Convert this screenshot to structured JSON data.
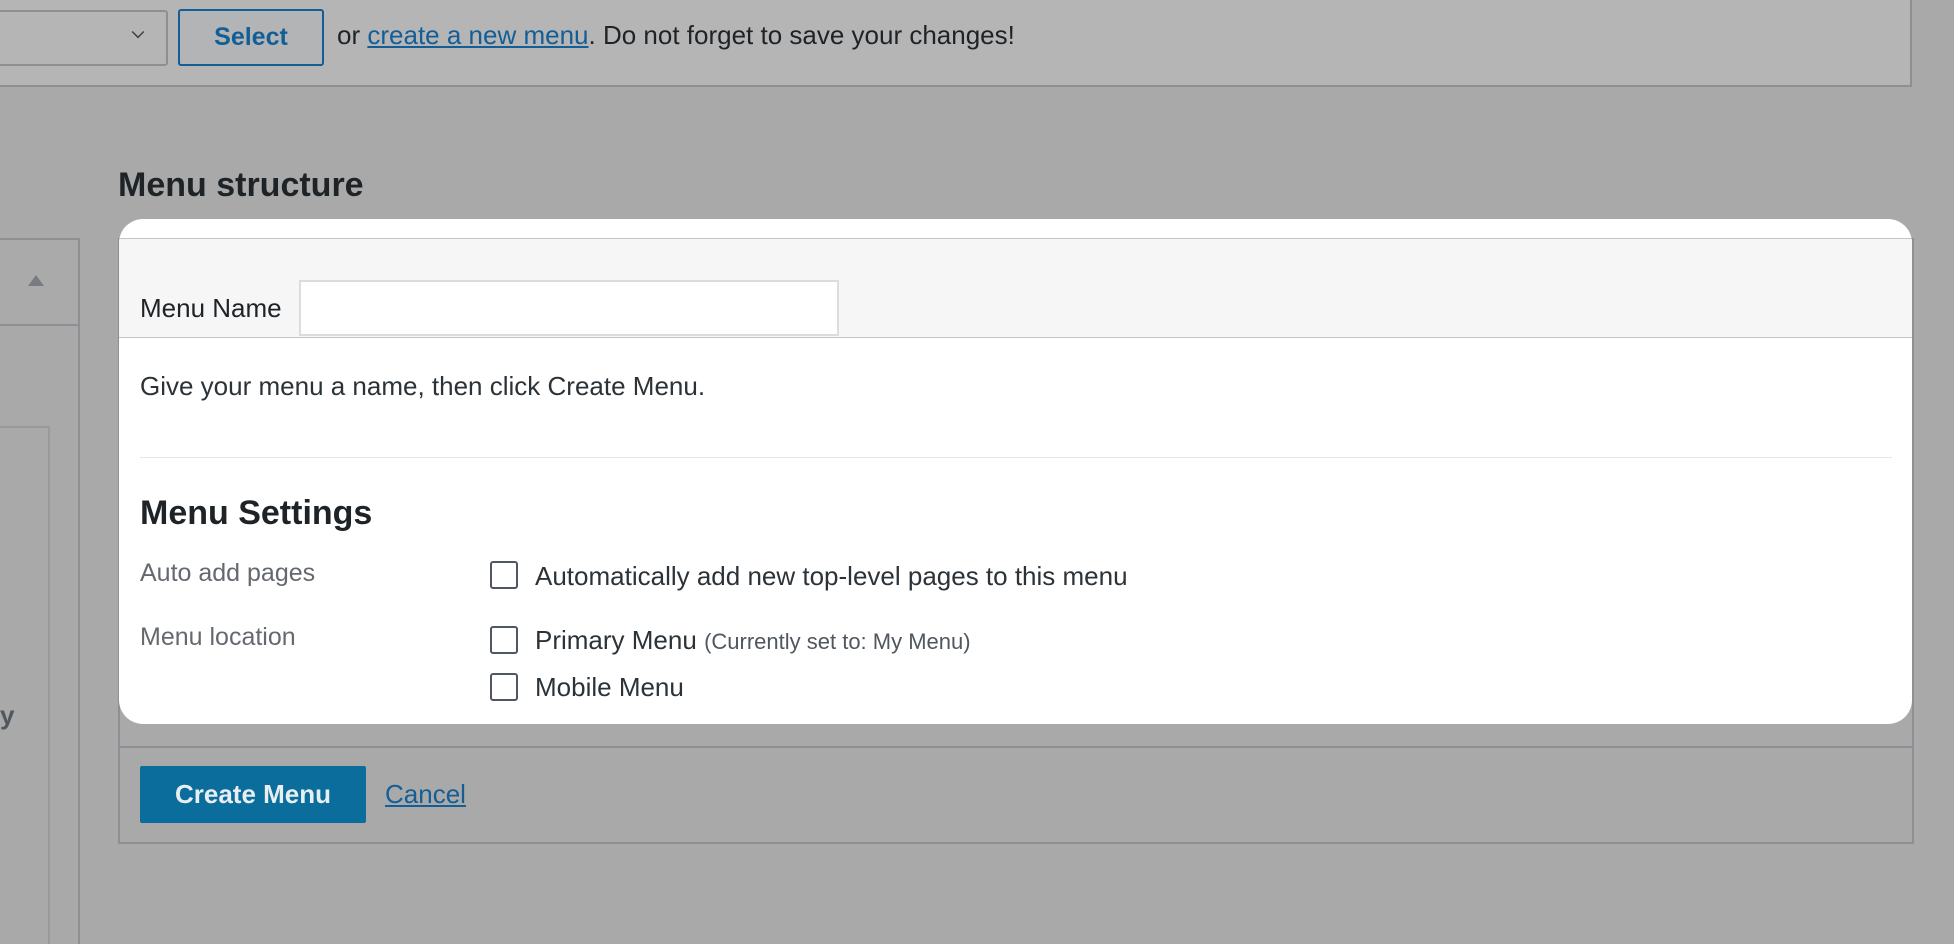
{
  "select_bar": {
    "button_label": "Select",
    "prefix": "or",
    "link_text": "create a new menu",
    "suffix": ". Do not forget to save your changes!"
  },
  "structure": {
    "title": "Menu structure",
    "menu_name_label": "Menu Name",
    "menu_name_value": "",
    "hint": "Give your menu a name, then click Create Menu.",
    "settings_title": "Menu Settings",
    "auto_add_label": "Auto add pages",
    "auto_add_option": "Automatically add new top-level pages to this menu",
    "location_label": "Menu location",
    "locations": [
      {
        "label": "Primary Menu",
        "note": "(Currently set to: My Menu)"
      },
      {
        "label": "Mobile Menu",
        "note": ""
      }
    ],
    "create_button": "Create Menu",
    "cancel_link": "Cancel"
  },
  "sidebar": {
    "partial_text": "y"
  },
  "colors": {
    "accent": "#135e96",
    "primary_button": "#0a6d9c"
  }
}
